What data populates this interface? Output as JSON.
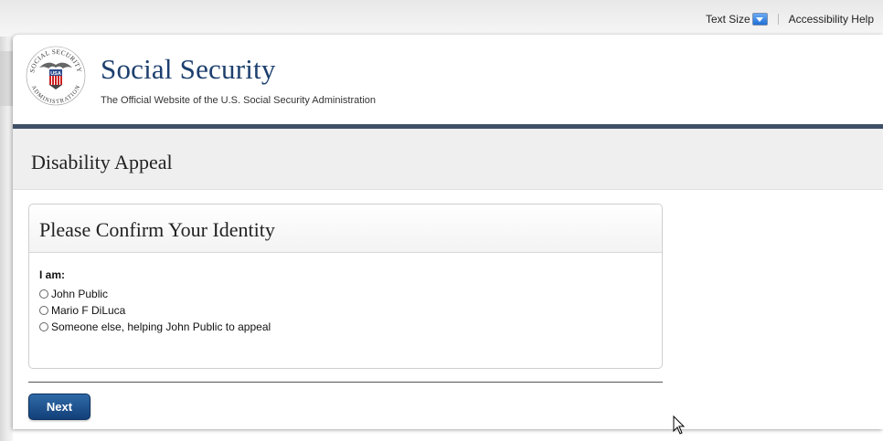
{
  "utility": {
    "text_size_label": "Text Size",
    "accessibility_help": "Accessibility Help"
  },
  "header": {
    "site_title": "Social Security",
    "site_subtitle": "The Official Website of the U.S. Social Security Administration",
    "seal": {
      "top_text": "SOCIAL SECURITY",
      "bottom_text": "ADMINISTRATION",
      "center_text": "USA"
    }
  },
  "page": {
    "title": "Disability Appeal"
  },
  "identity_panel": {
    "title": "Please Confirm Your Identity",
    "prompt": "I am:",
    "options": [
      "John Public",
      "Mario F DiLuca",
      "Someone else, helping John Public to appeal"
    ]
  },
  "actions": {
    "next_label": "Next"
  },
  "colors": {
    "brand_navy": "#1c3f6e",
    "header_rule": "#3f4f66",
    "button_blue": "#12407a"
  }
}
